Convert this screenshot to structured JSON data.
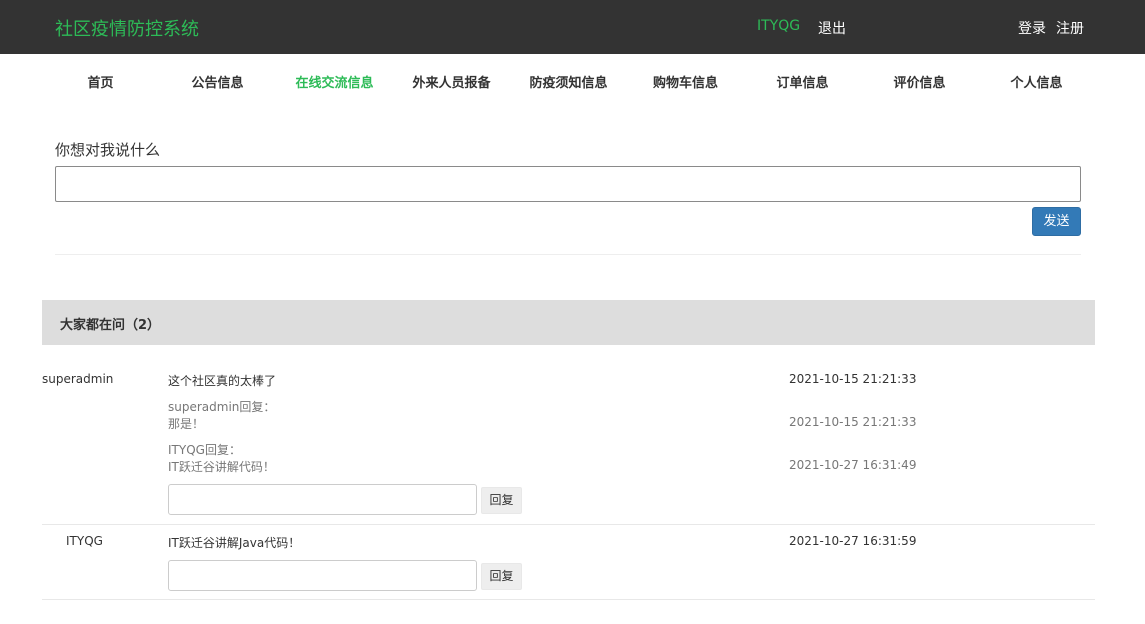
{
  "header": {
    "brand": "社区疫情防控系统",
    "username": "ITYQG",
    "logout": "退出",
    "login": "登录",
    "register": "注册"
  },
  "nav": {
    "items": [
      {
        "label": "首页"
      },
      {
        "label": "公告信息"
      },
      {
        "label": "在线交流信息"
      },
      {
        "label": "外来人员报备"
      },
      {
        "label": "防疫须知信息"
      },
      {
        "label": "购物车信息"
      },
      {
        "label": "订单信息"
      },
      {
        "label": "评价信息"
      },
      {
        "label": "个人信息"
      }
    ],
    "active": "在线交流信息"
  },
  "message_form": {
    "label": "你想对我说什么",
    "value": "",
    "send_label": "发送"
  },
  "discussion": {
    "title": "大家都在问（2）",
    "posts": [
      {
        "author": "superadmin",
        "content": "这个社区真的太棒了",
        "time": "2021-10-15 21:21:33",
        "replies": [
          {
            "name": "superadmin回复：",
            "text": "那是！",
            "time": "2021-10-15 21:21:33"
          },
          {
            "name": "ITYQG回复：",
            "text": "IT跃迁谷讲解代码！",
            "time": "2021-10-27 16:31:49"
          }
        ],
        "reply_input_value": "",
        "reply_button": "回复"
      },
      {
        "author": "ITYQG",
        "content": "IT跃迁谷讲解Java代码！",
        "time": "2021-10-27 16:31:59",
        "replies": [],
        "reply_input_value": "",
        "reply_button": "回复"
      }
    ]
  },
  "colors": {
    "topbar_bg": "#333333",
    "accent_green": "#2dbb57",
    "primary_button": "#337ab7",
    "panel_header_bg": "#dddddd"
  }
}
